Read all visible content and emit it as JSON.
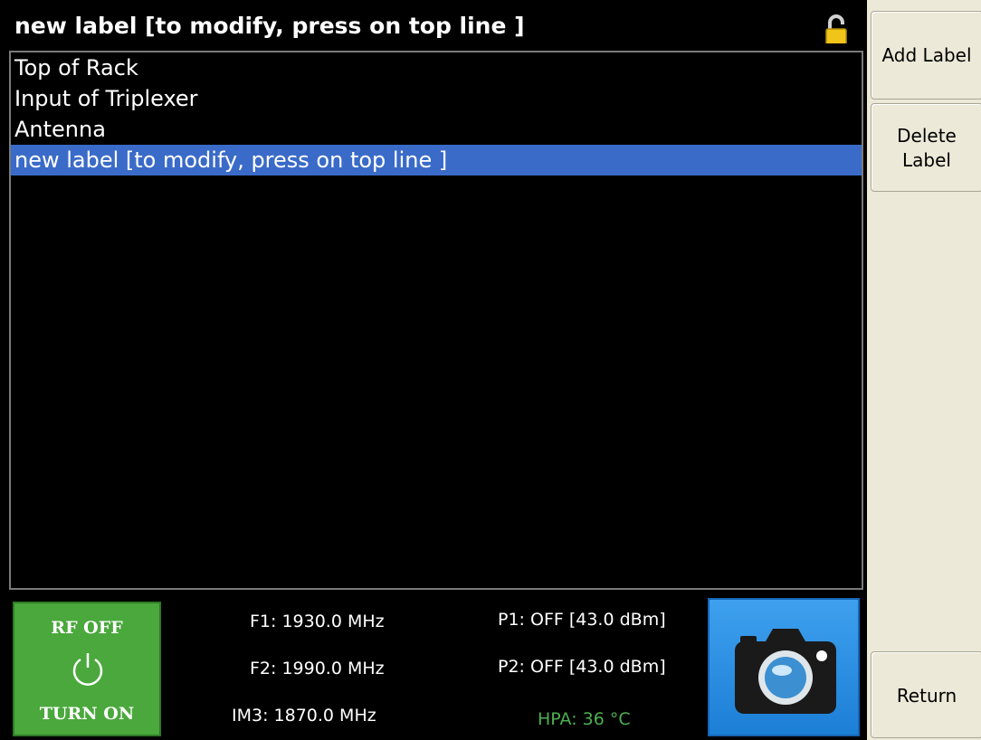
{
  "title": "new label [to modify, press on top line ]",
  "labels": [
    {
      "text": "Top of Rack",
      "selected": false
    },
    {
      "text": "Input of Triplexer",
      "selected": false
    },
    {
      "text": "Antenna",
      "selected": false
    },
    {
      "text": "new label [to modify, press on top line ]",
      "selected": true
    }
  ],
  "status": {
    "rf_state": "RF OFF",
    "rf_action": "TURN ON",
    "f1": "F1: 1930.0 MHz",
    "f2": "F2: 1990.0 MHz",
    "im3": "IM3: 1870.0 MHz",
    "p1": "P1: OFF [43.0 dBm]",
    "p2": "P2: OFF [43.0 dBm]",
    "hpa": "HPA: 36 °C"
  },
  "side_buttons": {
    "add_label": "Add Label",
    "delete_label": "Delete Label",
    "return": "Return"
  },
  "icons": {
    "lock": "lock-open-icon",
    "power": "power-icon",
    "camera": "camera-icon"
  },
  "colors": {
    "selection": "#3a6bc8",
    "rf_button": "#4aa83c",
    "hpa_text": "#4caf50",
    "camera_button": "#1c7fd6",
    "lock": "#f0c419"
  }
}
